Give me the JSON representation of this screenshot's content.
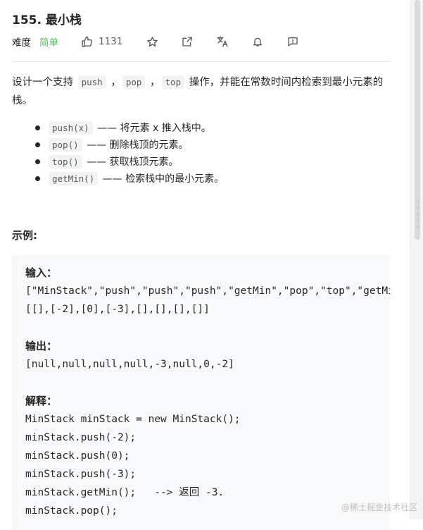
{
  "problem": {
    "title": "155. 最小栈",
    "difficulty_label": "难度",
    "difficulty_value": "简单",
    "likes": "1131",
    "difficulty_color": "#5cb85c"
  },
  "toolbar_icons": [
    "thumbs-up-icon",
    "star-icon",
    "share-icon",
    "translate-icon",
    "bell-icon",
    "feedback-icon"
  ],
  "description": {
    "part1": "设计一个支持 ",
    "code_push": "push",
    "sep1": " ，",
    "code_pop": "pop",
    "sep2": " ，",
    "code_top": "top",
    "part2": " 操作，并能在常数时间内检索到最小元素的栈。"
  },
  "operations": [
    {
      "code": "push(x)",
      "text": " —— 将元素 x 推入栈中。"
    },
    {
      "code": "pop()",
      "text": " —— 删除栈顶的元素。"
    },
    {
      "code": "top()",
      "text": " —— 获取栈顶元素。"
    },
    {
      "code": "getMin()",
      "text": " —— 检索栈中的最小元素。"
    }
  ],
  "example": {
    "heading": "示例:",
    "input_label": "输入：",
    "input_line1": "[\"MinStack\",\"push\",\"push\",\"push\",\"getMin\",\"pop\",\"top\",\"getMin\"]",
    "input_line2": "[[],[-2],[0],[-3],[],[],[],[]]",
    "output_label": "输出：",
    "output_line": "[null,null,null,null,-3,null,0,-2]",
    "explain_label": "解释：",
    "explain_lines": [
      "MinStack minStack = new MinStack();",
      "minStack.push(-2);",
      "minStack.push(0);",
      "minStack.push(-3);",
      "minStack.getMin();   --> 返回 -3.",
      "minStack.pop();"
    ]
  },
  "watermark": "@稀土掘金技术社区"
}
